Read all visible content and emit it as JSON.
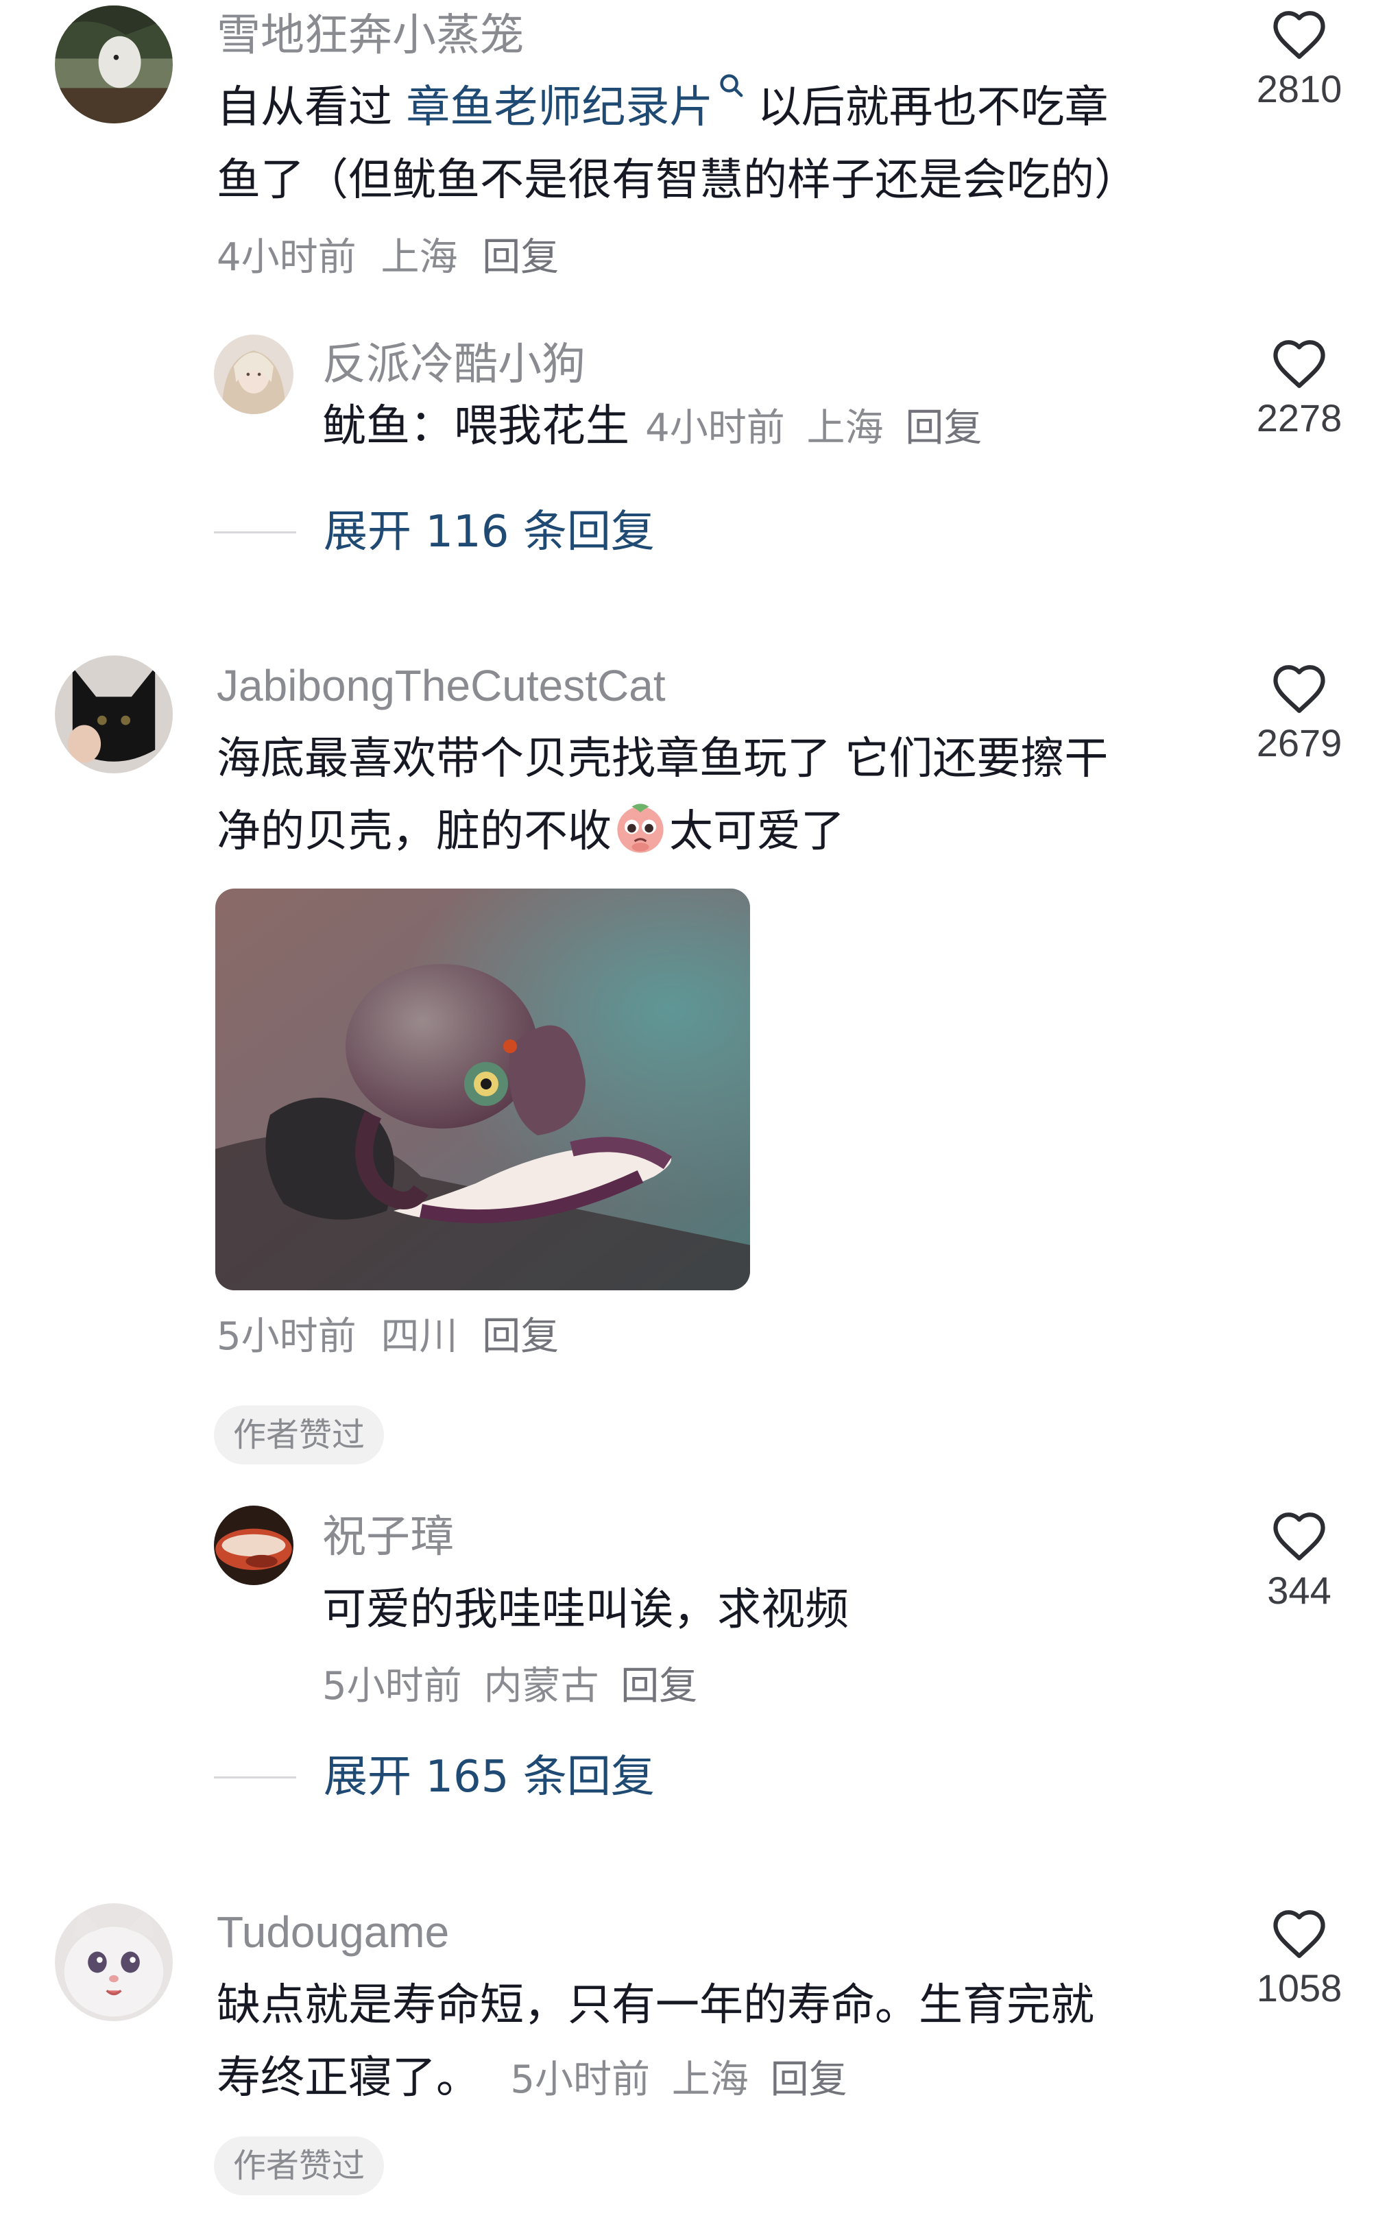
{
  "comments": [
    {
      "username": "雪地狂奔小蒸笼",
      "text_before": "自从看过 ",
      "link_text": "章鱼老师纪录片",
      "text_after_line1": " 以后就再也不吃章",
      "text_line2": "鱼了（但鱿鱼不是很有智慧的样子还是会吃的）",
      "meta_time": "4小时前",
      "meta_location": "上海",
      "reply_label": "回复",
      "likes": "2810",
      "replies": [
        {
          "username": "反派冷酷小狗",
          "text": "鱿鱼：喂我花生",
          "meta_time": "4小时前",
          "meta_location": "上海",
          "reply_label": "回复",
          "likes": "2278"
        }
      ],
      "expand_label": "展开 116 条回复"
    },
    {
      "username": "JabibongTheCutestCat",
      "text_line1": "海底最喜欢带个贝壳找章鱼玩了 它们还要擦干",
      "text_line2_before": "净的贝壳，脏的不收",
      "emoji": "pleading-face-emoji",
      "text_line2_after": "太可爱了",
      "meta_time": "5小时前",
      "meta_location": "四川",
      "reply_label": "回复",
      "badge": "作者赞过",
      "likes": "2679",
      "replies": [
        {
          "username": "祝子璋",
          "text": "可爱的我哇哇叫诶，求视频",
          "meta_time": "5小时前",
          "meta_location": "内蒙古",
          "reply_label": "回复",
          "likes": "344"
        }
      ],
      "expand_label": "展开 165 条回复"
    },
    {
      "username": "Tudougame",
      "text_line1": "缺点就是寿命短，只有一年的寿命。生育完就",
      "text_line2": "寿终正寝了。",
      "meta_time": "5小时前",
      "meta_location": "上海",
      "reply_label": "回复",
      "badge": "作者赞过",
      "likes": "1058"
    }
  ],
  "colors": {
    "username": "#8a8b91",
    "text": "#161823",
    "link": "#1f4a73",
    "badge_bg": "#f1f1f2"
  },
  "icons": {
    "like": "heart-outline-icon",
    "search_hint": "search-icon"
  }
}
